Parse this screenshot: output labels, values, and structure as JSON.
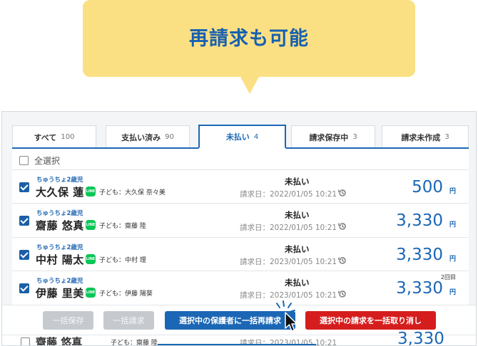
{
  "callout": {
    "title": "再請求も可能"
  },
  "tabs": [
    {
      "label": "すべて",
      "count": "100"
    },
    {
      "label": "支払い済み",
      "count": "90"
    },
    {
      "label": "未払い",
      "count": "4"
    },
    {
      "label": "請求保存中",
      "count": "3"
    },
    {
      "label": "請求未作成",
      "count": "3"
    }
  ],
  "select_all": {
    "label": "全選択"
  },
  "rows": [
    {
      "class": "ちゅうちょ2歳児",
      "name": "大久保 蓮",
      "line": "LINE",
      "child": "子ども：大久保 奈々美",
      "status": "未払い",
      "date": "請求日：2022/01/05 10:21",
      "amount": "500",
      "yen": "円",
      "nth": ""
    },
    {
      "class": "ちゅうちょ2歳児",
      "name": "齋藤 悠真",
      "line": "LINE",
      "child": "子ども：齋藤 陸",
      "status": "未払い",
      "date": "請求日：2022/01/05 10:21",
      "amount": "3,330",
      "yen": "円",
      "nth": ""
    },
    {
      "class": "ちゅうちょ2歳児",
      "name": "中村 陽太",
      "line": "LINE",
      "child": "子ども：中村 理",
      "status": "未払い",
      "date": "請求日：2023/01/05 10:21",
      "amount": "3,330",
      "yen": "円",
      "nth": ""
    },
    {
      "class": "ちゅうちょ2歳児",
      "name": "伊藤 里美",
      "line": "LINE",
      "child": "子ども：伊藤 陽葵",
      "status": "未払い",
      "date": "請求日：2023/01/05 10:21",
      "amount": "3,330",
      "yen": "円",
      "nth": "2回目"
    }
  ],
  "ghost_row": {
    "name": "齋藤 悠真",
    "child": "子ども：齋藤 陸",
    "date": "請求日：2023/01/05 10:21",
    "amount": "3,330"
  },
  "actions": {
    "bulk_save": "一括保存",
    "bulk_bill": "一括請求",
    "rebill": "選択中の保護者に一括再請求",
    "cancel": "選択中の請求を一括取り消し"
  },
  "colors": {
    "accent": "#1b67b5",
    "callout": "#fbe083",
    "danger": "#d61d1d",
    "line": "#06c755"
  }
}
